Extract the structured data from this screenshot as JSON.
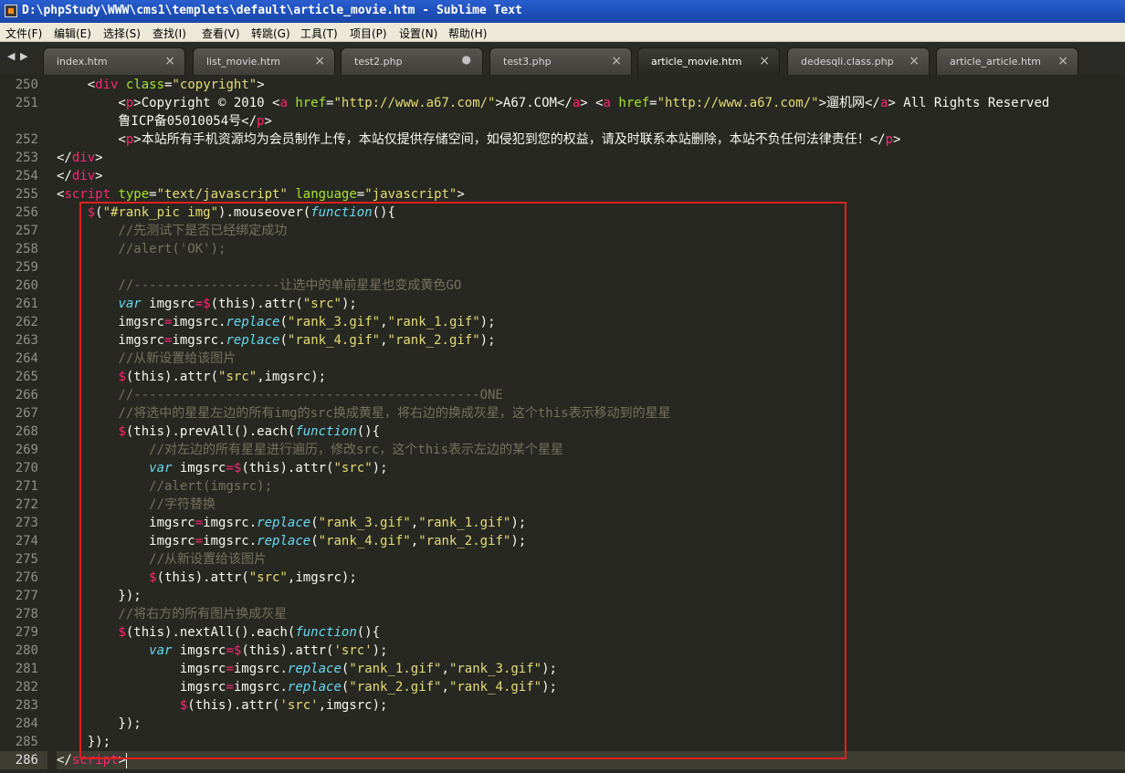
{
  "window": {
    "title": "D:\\phpStudy\\WWW\\cms1\\templets\\default\\article_movie.htm - Sublime Text"
  },
  "menu": [
    "文件(F)",
    "编辑(E)",
    "选择(S)",
    "查找(I)",
    "查看(V)",
    "转跳(G)",
    "工具(T)",
    "项目(P)",
    "设置(N)",
    "帮助(H)"
  ],
  "tab_nav": {
    "prev": "◀",
    "next": "▶"
  },
  "tabs": [
    {
      "label": "index.htm",
      "close": "×"
    },
    {
      "label": "list_movie.htm",
      "close": "×"
    },
    {
      "label": "test2.php",
      "close": "●"
    },
    {
      "label": "test3.php",
      "close": "×"
    },
    {
      "label": "article_movie.htm",
      "close": "×"
    },
    {
      "label": "dedesqli.class.php",
      "close": "×"
    },
    {
      "label": "article_article.htm",
      "close": "×"
    }
  ],
  "active_tab": "article_movie.htm",
  "line_numbers": [
    "250",
    "251",
    "",
    "252",
    "253",
    "254",
    "255",
    "256",
    "257",
    "258",
    "259",
    "260",
    "261",
    "262",
    "263",
    "264",
    "265",
    "266",
    "267",
    "268",
    "269",
    "270",
    "271",
    "272",
    "273",
    "274",
    "275",
    "276",
    "277",
    "278",
    "279",
    "280",
    "281",
    "282",
    "283",
    "284",
    "285",
    "286"
  ],
  "current_line": "286",
  "code": [
    [
      [
        "w",
        "    <"
      ],
      [
        "t",
        "div"
      ],
      [
        "w",
        " "
      ],
      [
        "a",
        "class"
      ],
      [
        "w",
        "="
      ],
      [
        "s",
        "\"copyright\""
      ],
      [
        "w",
        ">"
      ]
    ],
    [
      [
        "w",
        "        <"
      ],
      [
        "t",
        "p"
      ],
      [
        "w",
        ">Copyright © 2010 <"
      ],
      [
        "t",
        "a"
      ],
      [
        "w",
        " "
      ],
      [
        "a",
        "href"
      ],
      [
        "w",
        "="
      ],
      [
        "s",
        "\"http://www.a67.com/\""
      ],
      [
        "w",
        ">A67.COM</"
      ],
      [
        "t",
        "a"
      ],
      [
        "w",
        "> <"
      ],
      [
        "t",
        "a"
      ],
      [
        "w",
        " "
      ],
      [
        "a",
        "href"
      ],
      [
        "w",
        "="
      ],
      [
        "s",
        "\"http://www.a67.com/\""
      ],
      [
        "w",
        ">遛机网</"
      ],
      [
        "t",
        "a"
      ],
      [
        "w",
        "> All Rights Reserved"
      ]
    ],
    [
      [
        "w",
        "        鲁ICP备05010054号</"
      ],
      [
        "t",
        "p"
      ],
      [
        "w",
        ">"
      ]
    ],
    [
      [
        "w",
        "        <"
      ],
      [
        "t",
        "p"
      ],
      [
        "w",
        ">本站所有手机资源均为会员制作上传，本站仅提供存储空间，如侵犯到您的权益，请及时联系本站删除，本站不负任何法律责任！</"
      ],
      [
        "t",
        "p"
      ],
      [
        "w",
        ">"
      ]
    ],
    [
      [
        "w",
        "</"
      ],
      [
        "t",
        "div"
      ],
      [
        "w",
        ">"
      ]
    ],
    [
      [
        "w",
        "</"
      ],
      [
        "t",
        "div"
      ],
      [
        "w",
        ">"
      ]
    ],
    [
      [
        "w",
        "<"
      ],
      [
        "t",
        "script"
      ],
      [
        "w",
        " "
      ],
      [
        "a",
        "type"
      ],
      [
        "w",
        "="
      ],
      [
        "s",
        "\"text/javascript\""
      ],
      [
        "w",
        " "
      ],
      [
        "a",
        "language"
      ],
      [
        "w",
        "="
      ],
      [
        "s",
        "\"javascript\""
      ],
      [
        "w",
        ">"
      ]
    ],
    [
      [
        "w",
        "    "
      ],
      [
        "t",
        "$"
      ],
      [
        "w",
        "("
      ],
      [
        "s",
        "\"#rank_pic img\""
      ],
      [
        "w",
        ").mouseover("
      ],
      [
        "k",
        "function"
      ],
      [
        "w",
        "(){"
      ]
    ],
    [
      [
        "c",
        "        //先测试下是否已经绑定成功"
      ]
    ],
    [
      [
        "c",
        "        //alert('OK');"
      ]
    ],
    [
      [
        "w",
        ""
      ]
    ],
    [
      [
        "c",
        "        //-------------------让选中的单前星星也变成黄色GO"
      ]
    ],
    [
      [
        "w",
        "        "
      ],
      [
        "k",
        "var"
      ],
      [
        "w",
        " imgsrc"
      ],
      [
        "t",
        "="
      ],
      [
        "t",
        "$"
      ],
      [
        "w",
        "(this).attr("
      ],
      [
        "s",
        "\"src\""
      ],
      [
        "w",
        ");"
      ]
    ],
    [
      [
        "w",
        "        imgsrc"
      ],
      [
        "t",
        "="
      ],
      [
        "w",
        "imgsrc."
      ],
      [
        "k",
        "replace"
      ],
      [
        "w",
        "("
      ],
      [
        "s",
        "\"rank_3.gif\""
      ],
      [
        "w",
        ","
      ],
      [
        "s",
        "\"rank_1.gif\""
      ],
      [
        "w",
        ");"
      ]
    ],
    [
      [
        "w",
        "        imgsrc"
      ],
      [
        "t",
        "="
      ],
      [
        "w",
        "imgsrc."
      ],
      [
        "k",
        "replace"
      ],
      [
        "w",
        "("
      ],
      [
        "s",
        "\"rank_4.gif\""
      ],
      [
        "w",
        ","
      ],
      [
        "s",
        "\"rank_2.gif\""
      ],
      [
        "w",
        ");"
      ]
    ],
    [
      [
        "c",
        "        //从新设置给该图片"
      ]
    ],
    [
      [
        "w",
        "        "
      ],
      [
        "t",
        "$"
      ],
      [
        "w",
        "(this).attr("
      ],
      [
        "s",
        "\"src\""
      ],
      [
        "w",
        ",imgsrc);"
      ]
    ],
    [
      [
        "c",
        "        //---------------------------------------------ONE"
      ]
    ],
    [
      [
        "c",
        "        //将选中的星星左边的所有img的src换成黄星，将右边的换成灰星，这个this表示移动到的星星"
      ]
    ],
    [
      [
        "w",
        "        "
      ],
      [
        "t",
        "$"
      ],
      [
        "w",
        "(this).prevAll().each("
      ],
      [
        "k",
        "function"
      ],
      [
        "w",
        "(){"
      ]
    ],
    [
      [
        "c",
        "            //对左边的所有星星进行遍历，修改src，这个this表示左边的某个星星"
      ]
    ],
    [
      [
        "w",
        "            "
      ],
      [
        "k",
        "var"
      ],
      [
        "w",
        " imgsrc"
      ],
      [
        "t",
        "="
      ],
      [
        "t",
        "$"
      ],
      [
        "w",
        "(this).attr("
      ],
      [
        "s",
        "\"src\""
      ],
      [
        "w",
        ");"
      ]
    ],
    [
      [
        "c",
        "            //alert(imgsrc);"
      ]
    ],
    [
      [
        "c",
        "            //字符替换"
      ]
    ],
    [
      [
        "w",
        "            imgsrc"
      ],
      [
        "t",
        "="
      ],
      [
        "w",
        "imgsrc."
      ],
      [
        "k",
        "replace"
      ],
      [
        "w",
        "("
      ],
      [
        "s",
        "\"rank_3.gif\""
      ],
      [
        "w",
        ","
      ],
      [
        "s",
        "\"rank_1.gif\""
      ],
      [
        "w",
        ");"
      ]
    ],
    [
      [
        "w",
        "            imgsrc"
      ],
      [
        "t",
        "="
      ],
      [
        "w",
        "imgsrc."
      ],
      [
        "k",
        "replace"
      ],
      [
        "w",
        "("
      ],
      [
        "s",
        "\"rank_4.gif\""
      ],
      [
        "w",
        ","
      ],
      [
        "s",
        "\"rank_2.gif\""
      ],
      [
        "w",
        ");"
      ]
    ],
    [
      [
        "c",
        "            //从新设置给该图片"
      ]
    ],
    [
      [
        "w",
        "            "
      ],
      [
        "t",
        "$"
      ],
      [
        "w",
        "(this).attr("
      ],
      [
        "s",
        "\"src\""
      ],
      [
        "w",
        ",imgsrc);"
      ]
    ],
    [
      [
        "w",
        "        });"
      ]
    ],
    [
      [
        "c",
        "        //将右方的所有图片换成灰星"
      ]
    ],
    [
      [
        "w",
        "        "
      ],
      [
        "t",
        "$"
      ],
      [
        "w",
        "(this).nextAll().each("
      ],
      [
        "k",
        "function"
      ],
      [
        "w",
        "(){"
      ]
    ],
    [
      [
        "w",
        "            "
      ],
      [
        "k",
        "var"
      ],
      [
        "w",
        " imgsrc"
      ],
      [
        "t",
        "="
      ],
      [
        "t",
        "$"
      ],
      [
        "w",
        "(this).attr("
      ],
      [
        "s",
        "'src'"
      ],
      [
        "w",
        ");"
      ]
    ],
    [
      [
        "w",
        "                imgsrc"
      ],
      [
        "t",
        "="
      ],
      [
        "w",
        "imgsrc."
      ],
      [
        "k",
        "replace"
      ],
      [
        "w",
        "("
      ],
      [
        "s",
        "\"rank_1.gif\""
      ],
      [
        "w",
        ","
      ],
      [
        "s",
        "\"rank_3.gif\""
      ],
      [
        "w",
        ");"
      ]
    ],
    [
      [
        "w",
        "                imgsrc"
      ],
      [
        "t",
        "="
      ],
      [
        "w",
        "imgsrc."
      ],
      [
        "k",
        "replace"
      ],
      [
        "w",
        "("
      ],
      [
        "s",
        "\"rank_2.gif\""
      ],
      [
        "w",
        ","
      ],
      [
        "s",
        "\"rank_4.gif\""
      ],
      [
        "w",
        ");"
      ]
    ],
    [
      [
        "w",
        "                "
      ],
      [
        "t",
        "$"
      ],
      [
        "w",
        "(this).attr("
      ],
      [
        "s",
        "'src'"
      ],
      [
        "w",
        ",imgsrc);"
      ]
    ],
    [
      [
        "w",
        "        });"
      ]
    ],
    [
      [
        "w",
        "    });"
      ]
    ],
    [
      [
        "w",
        "</"
      ],
      [
        "t",
        "script"
      ],
      [
        "w",
        ">"
      ]
    ]
  ],
  "colors": {
    "background": "#272822",
    "tag": "#f92672",
    "attribute": "#a6e22e",
    "string": "#e6db74",
    "comment": "#75715e",
    "keyword": "#66d9ef",
    "text": "#f8f8f2",
    "highlight_box": "#e02020"
  }
}
